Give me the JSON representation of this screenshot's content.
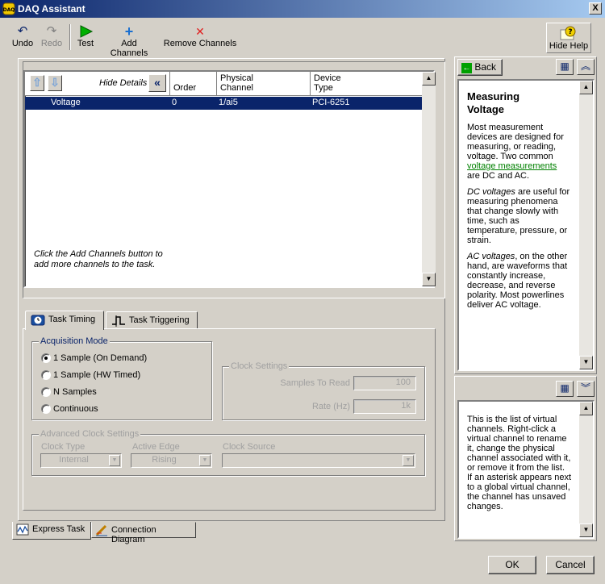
{
  "window": {
    "title": "DAQ Assistant",
    "close_glyph": "X"
  },
  "toolbar": {
    "undo": "Undo",
    "redo": "Redo",
    "test": "Test",
    "add_channels": "Add Channels",
    "remove_channels": "Remove Channels",
    "hide_help": "Hide Help"
  },
  "channels": {
    "hide_details": "Hide Details",
    "columns": {
      "order": "Order",
      "physical_channel_1": "Physical",
      "physical_channel_2": "Channel",
      "device_type_1": "Device",
      "device_type_2": "Type"
    },
    "rows": [
      {
        "name": "Voltage",
        "order": "0",
        "physical": "1/ai5",
        "device": "PCI-6251"
      }
    ],
    "hint_line1": "Click the Add Channels button to",
    "hint_line2": "add more channels to the task."
  },
  "tabs": {
    "timing": "Task Timing",
    "triggering": "Task Triggering"
  },
  "acquisition": {
    "title": "Acquisition Mode",
    "options": [
      "1 Sample (On Demand)",
      "1 Sample (HW Timed)",
      "N Samples",
      "Continuous"
    ],
    "selected": 0
  },
  "clock": {
    "title": "Clock Settings",
    "samples_label": "Samples To Read",
    "samples_value": "100",
    "rate_label": "Rate (Hz)",
    "rate_value": "1k"
  },
  "advanced": {
    "title": "Advanced Clock Settings",
    "type_label": "Clock Type",
    "type_value": "Internal",
    "edge_label": "Active Edge",
    "edge_value": "Rising",
    "source_label": "Clock Source",
    "source_value": ""
  },
  "bottom_tabs": {
    "express": "Express Task",
    "diagram": "Connection Diagram"
  },
  "help": {
    "back": "Back",
    "heading_1": "Measuring",
    "heading_2": "Voltage",
    "p1_a": "Most measurement devices are designed for measuring, or reading, voltage. Two common ",
    "p1_link": "voltage measurements",
    "p1_b": " are DC and AC.",
    "p2_em": "DC voltages",
    "p2": " are useful for measuring phenomena that change slowly with time, such as temperature, pressure, or strain.",
    "p3_em": "AC voltages",
    "p3": ", on the other hand, are waveforms that constantly increase, decrease, and reverse polarity. Most powerlines deliver AC voltage.",
    "context": "This is the list of virtual channels. Right-click a virtual channel to rename it, change the physical channel associated with it, or remove it from the list. If an asterisk appears next to a global virtual channel, the channel has unsaved changes."
  },
  "buttons": {
    "ok": "OK",
    "cancel": "Cancel"
  }
}
